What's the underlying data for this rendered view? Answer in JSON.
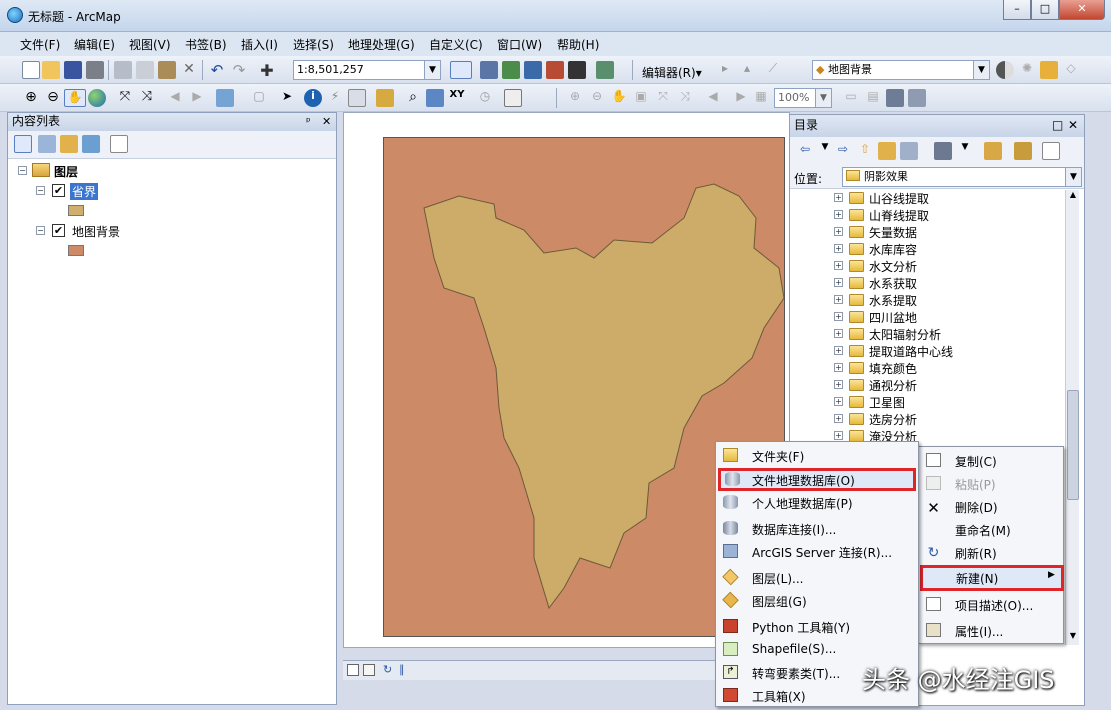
{
  "window": {
    "title": "无标题 - ArcMap",
    "buttons": [
      "–",
      "□",
      "✕"
    ]
  },
  "menubar": [
    "文件(F)",
    "编辑(E)",
    "视图(V)",
    "书签(B)",
    "插入(I)",
    "选择(S)",
    "地理处理(G)",
    "自定义(C)",
    "窗口(W)",
    "帮助(H)"
  ],
  "toolbar": {
    "scale": "1:8,501,257",
    "editor": "编辑器(R)▾",
    "layer_combo": "地图背景",
    "zoom": "100%"
  },
  "toc": {
    "title": "内容列表",
    "root": "图层",
    "layers": [
      {
        "name": "省界",
        "swatch": "#cfae6e"
      },
      {
        "name": "地图背景",
        "swatch": "#cd8a67"
      }
    ]
  },
  "map": {
    "background_color": "#cd8a67",
    "province_color": "#cdab69"
  },
  "catalog": {
    "title": "目录",
    "location_label": "位置:",
    "location_value": "阴影效果",
    "items": [
      "山谷线提取",
      "山脊线提取",
      "矢量数据",
      "水库库容",
      "水文分析",
      "水系获取",
      "水系提取",
      "四川盆地",
      "太阳辐射分析",
      "提取道路中心线",
      "填充颜色",
      "通视分析",
      "卫星图",
      "选房分析",
      "淹没分析"
    ]
  },
  "context_menu": {
    "items": [
      "复制(C)",
      "粘贴(P)",
      "删除(D)",
      "重命名(M)",
      "刷新(R)",
      "新建(N)",
      "项目描述(O)...",
      "属性(I)..."
    ],
    "highlighted": "新建(N)"
  },
  "new_submenu": {
    "items": [
      "文件夹(F)",
      "文件地理数据库(O)",
      "个人地理数据库(P)",
      "数据库连接(I)...",
      "ArcGIS Server 连接(R)...",
      "图层(L)...",
      "图层组(G)",
      "Python 工具箱(Y)",
      "Shapefile(S)...",
      "转弯要素类(T)...",
      "工具箱(X)"
    ],
    "highlighted": "文件地理数据库(O)"
  },
  "watermark": "头条 @水经注GIS"
}
